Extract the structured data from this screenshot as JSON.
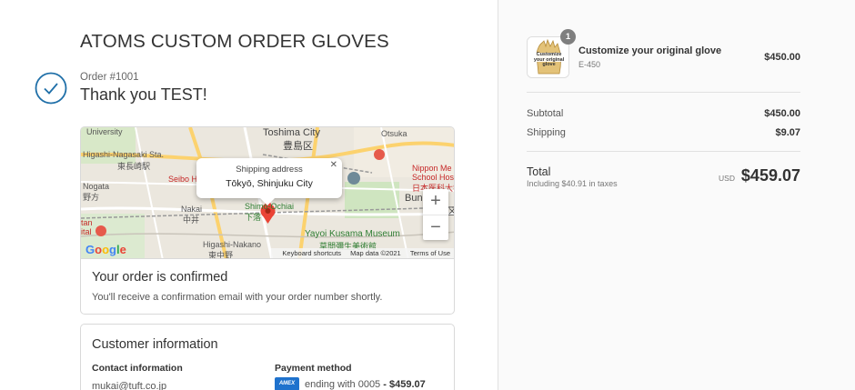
{
  "store": {
    "title": "ATOMS CUSTOM ORDER GLOVES"
  },
  "order": {
    "number": "Order #1001",
    "thanks": "Thank you TEST!"
  },
  "map": {
    "popup_title": "Shipping address",
    "popup_location": "Tōkyō, Shinjuku City",
    "zoom_in": "+",
    "zoom_out": "−",
    "google": "Google",
    "attribution": [
      "Keyboard shortcuts",
      "Map data ©2021",
      "Terms of Use"
    ],
    "labels": {
      "university": "University",
      "toshima": "Toshima City",
      "toshima_jp": "豊島区",
      "otsuka": "Otsuka",
      "higashi_nagasaki": "Higashi-Nagasaki Sta.",
      "higashi_nagasaki_jp": "東長崎駅",
      "seibo": "Seibo H",
      "nogata": "Nogata",
      "nogata_jp": "野方",
      "nakai": "Nakai",
      "nakai_jp": "中井",
      "shimo": "Shimo-Ochiai",
      "shimo_jp": "下落",
      "nippon1": "Nippon Me",
      "nippon2": "School Hos",
      "nippon_jp": "日本医科大学付",
      "bun": "Bun",
      "bun_jp": "区",
      "tan": "tan",
      "tan2": "ital",
      "yayoi": "Yayoi Kusama Museum",
      "yayoi_jp": "草間彌生美術館",
      "higashi_nakano": "Higashi-Nakano",
      "higashi_nakano_jp": "東中野"
    }
  },
  "confirmation": {
    "title": "Your order is confirmed",
    "message": "You'll receive a confirmation email with your order number shortly."
  },
  "customer": {
    "title": "Customer information",
    "contact_label": "Contact information",
    "email": "mukai@tuft.co.jp",
    "payment_label": "Payment method",
    "card_brand": "AMEX",
    "payment_text": "ending with 0005",
    "payment_amount": "- $459.07"
  },
  "summary": {
    "product_name": "Customize your original glove",
    "product_variant": "E-450",
    "quantity": "1",
    "product_price": "$450.00",
    "thumb_caption": "Customize your original glove",
    "subtotal_label": "Subtotal",
    "subtotal": "$450.00",
    "shipping_label": "Shipping",
    "shipping": "$9.07",
    "total_label": "Total",
    "tax_note": "Including $40.91 in taxes",
    "currency": "USD",
    "total": "$459.07"
  },
  "colors": {
    "accent": "#1f6fa8",
    "marker": "#e53935"
  }
}
